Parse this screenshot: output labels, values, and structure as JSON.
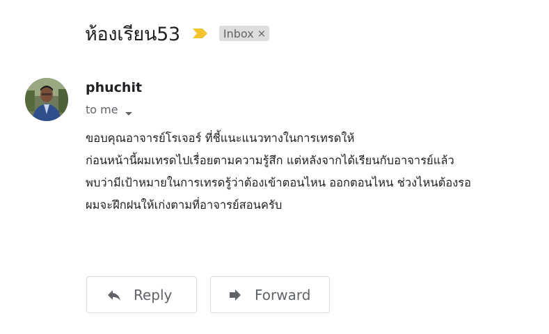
{
  "email": {
    "subject": "ห้องเรียน53",
    "importance_marker_icon": "importance-marker-icon",
    "importance_color": "#f4c430",
    "label": "Inbox",
    "label_close": "×",
    "sender": {
      "name": "phuchit",
      "avatar_icon": "user-avatar",
      "recipient": "to me",
      "recipient_dropdown_icon": "chevron-down-icon"
    },
    "body_lines": [
      "ขอบคุณอาจารย์โรเจอร์  ที่ชี้แนะแนวทางในการเทรดให้",
      "ก่อนหน้านี้ผมเทรดไปเรื่อยตามความรู้สึก  แต่หลังจากได้เรียนกับอาจารย์แล้ว",
      "พบว่ามีเป้าหมายในการเทรดรู้ว่าต้องเข้าตอนไหน  ออกตอนไหน  ช่วงไหนต้องรอ",
      "ผมจะฝึกฝนให้เก่งตามที่อาจารย์สอนครับ"
    ]
  },
  "actions": {
    "reply_label": "Reply",
    "reply_icon": "reply-icon",
    "forward_label": "Forward",
    "forward_icon": "forward-icon"
  },
  "colors": {
    "text_primary": "#202124",
    "text_secondary": "#5f6368",
    "chip_bg": "#dddddd",
    "button_border": "#dadce0"
  }
}
